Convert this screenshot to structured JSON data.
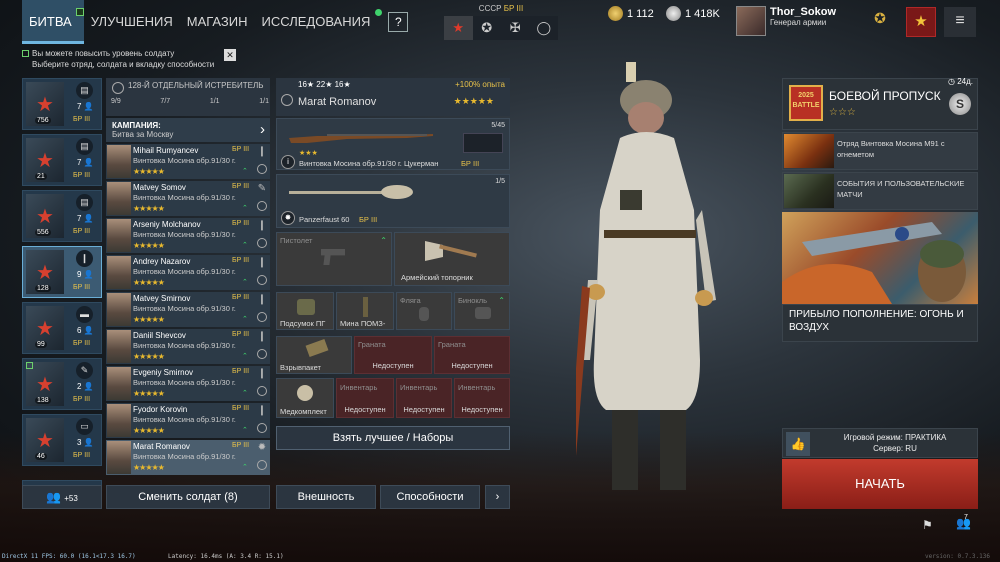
{
  "nav": {
    "items": [
      {
        "label": "БИТВА",
        "active": true
      },
      {
        "label": "УЛУЧШЕНИЯ",
        "active": false
      },
      {
        "label": "МАГАЗИН",
        "active": false
      },
      {
        "label": "ИССЛЕДОВАНИЯ",
        "active": false
      }
    ],
    "help": "?"
  },
  "nation": {
    "name": "СССР",
    "br": "БР III",
    "tab_icons": [
      "star-icon",
      "cross-icon",
      "plus-icon",
      "circle-icon"
    ]
  },
  "currency": {
    "gold": "1 112",
    "silver": "1 418K"
  },
  "profile": {
    "name": "Thor_Sokow",
    "rank": "Генерал армии"
  },
  "notice": {
    "line1": "Вы можете повысить уровень солдату",
    "line2": "Выберите отряд, солдата и вкладку способности"
  },
  "squads": [
    {
      "type_icon": "document-icon",
      "count": "7",
      "num": "756",
      "br": "БР III",
      "selected": false
    },
    {
      "type_icon": "document-icon",
      "count": "7",
      "num": "21",
      "br": "БР III",
      "selected": false
    },
    {
      "type_icon": "document-icon",
      "count": "7",
      "num": "556",
      "br": "БР III",
      "selected": false
    },
    {
      "type_icon": "knife-icon",
      "count": "9",
      "num": "128",
      "br": "БР III",
      "selected": true
    },
    {
      "type_icon": "tank-icon",
      "count": "6",
      "num": "99",
      "br": "БР III",
      "selected": false
    },
    {
      "type_icon": "sniper-icon",
      "count": "2",
      "num": "138",
      "br": "БР III",
      "selected": false
    },
    {
      "type_icon": "vehicle-icon",
      "count": "3",
      "num": "46",
      "br": "БР III",
      "selected": false
    }
  ],
  "squad_header": {
    "title": "128-Й ОТДЕЛЬНЫЙ ИСТРЕБИТЕЛЬ",
    "stats": [
      "9/9",
      "7/7",
      "1/1",
      "1/1"
    ]
  },
  "campaign": {
    "title": "КАМПАНИЯ:",
    "name": "Битва за Москву"
  },
  "soldiers": [
    {
      "name": "Mihail Rumyancev",
      "br": "БР III",
      "weapon": "Винтовка Мосина обр.91/30 г.",
      "stars": "★★★★★",
      "selected": false,
      "role": "❙"
    },
    {
      "name": "Matvey Somov",
      "br": "БР III",
      "weapon": "Винтовка Мосина обр.91/30 г.",
      "stars": "★★★★★",
      "selected": false,
      "role": "✎"
    },
    {
      "name": "Arseniy Molchanov",
      "br": "БР III",
      "weapon": "Винтовка Мосина обр.91/30 г.",
      "stars": "★★★★★",
      "selected": false,
      "role": "❙"
    },
    {
      "name": "Andrey Nazarov",
      "br": "БР III",
      "weapon": "Винтовка Мосина обр.91/30 г.",
      "stars": "★★★★★",
      "selected": false,
      "role": "❙"
    },
    {
      "name": "Matvey Smirnov",
      "br": "БР III",
      "weapon": "Винтовка Мосина обр.91/30 г.",
      "stars": "★★★★★",
      "selected": false,
      "role": "❙"
    },
    {
      "name": "Daniil Shevcov",
      "br": "БР III",
      "weapon": "Винтовка Мосина обр.91/30 г.",
      "stars": "★★★★★",
      "selected": false,
      "role": "❙"
    },
    {
      "name": "Evgeniy Smirnov",
      "br": "БР III",
      "weapon": "Винтовка Мосина обр.91/30 г.",
      "stars": "★★★★★",
      "selected": false,
      "role": "❙"
    },
    {
      "name": "Fyodor Korovin",
      "br": "БР III",
      "weapon": "Винтовка Мосина обр.91/30 г.",
      "stars": "★★★★★",
      "selected": false,
      "role": "❙"
    },
    {
      "name": "Marat Romanov",
      "br": "БР III",
      "weapon": "Винтовка Мосина обр.91/30 г.",
      "stars": "★★★★★",
      "selected": true,
      "role": "✹"
    }
  ],
  "soldier_detail": {
    "levels": "16★  22★  16★",
    "exp": "+100% опыта",
    "name": "Marat Romanov",
    "stars": "★★★★★",
    "primary": {
      "name": "Винтовка Мосина обр.91/30 г. Цукерман",
      "br": "БР III",
      "ammo": "5/45",
      "stars": "★★★"
    },
    "secondary": {
      "name": "Panzerfaust 60",
      "br": "БР III",
      "ammo": "1/5"
    },
    "pistol": "Пистолет",
    "melee": "Армейский топорник",
    "pouch": "Подсумок ПГ",
    "mine": "Мина ПОМЗ-",
    "flask": "Фляга",
    "binocular": "Бинокль",
    "explosive": "Взрывпакет",
    "medkit": "Медкомплект",
    "grenade": "Граната",
    "inventory": "Инвентарь",
    "unavailable": "Недоступен"
  },
  "buttons": {
    "best": "Взять лучшее / Наборы",
    "squad_reserve": "+53",
    "change_soldier": "Сменить солдат (8)",
    "appearance": "Внешность",
    "abilities": "Способности",
    "next": "›"
  },
  "battle_pass": {
    "logo": "2025 BATTLE",
    "title": "БОЕВОЙ ПРОПУСК",
    "stars": "☆☆☆",
    "days": "24д.",
    "coin": "S"
  },
  "promos": [
    {
      "text": "Отряд Винтовка Мосина М91 с огнеметом"
    },
    {
      "text": "СОБЫТИЯ И ПОЛЬЗОВАТЕЛЬСКИЕ МАТЧИ"
    }
  ],
  "promo_big": {
    "caption": "ПРИБЫЛО ПОПОЛНЕНИЕ: ОГОНЬ И ВОЗДУХ"
  },
  "mode": {
    "line1": "Игровой режим: ПРАКТИКА",
    "line2": "Сервер: RU"
  },
  "start": "НАЧАТЬ",
  "people_count": "7",
  "status": {
    "fps": "DirectX 11 FPS: 60.0 (16.1<17.3 16.7)",
    "latency": "Latency: 16.4ms (A: 3.4 R: 15.1)",
    "version": "version: 0.7.3.136"
  },
  "colors": {
    "accent": "#6fb6e0",
    "gold": "#e8c24a",
    "start": "#c23b2d",
    "locked": "#4a2426"
  }
}
